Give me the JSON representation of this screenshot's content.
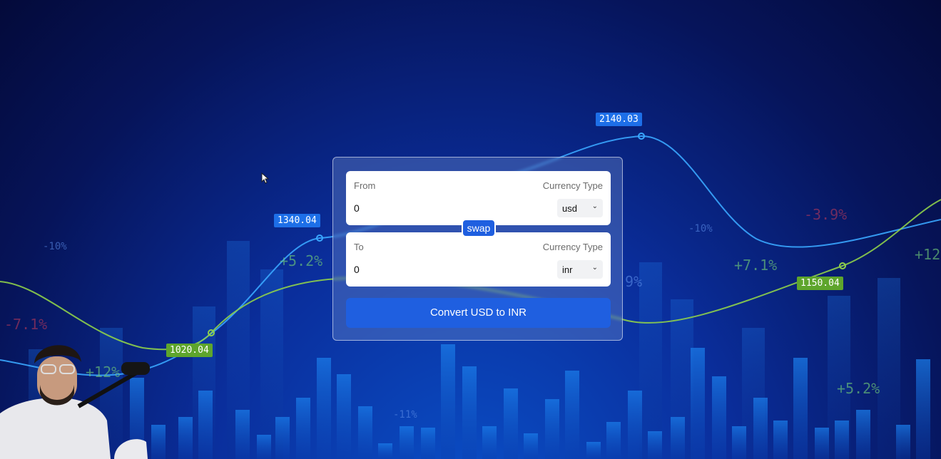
{
  "converter": {
    "from_label": "From",
    "to_label": "To",
    "currency_type_label": "Currency Type",
    "from_amount": "0",
    "to_amount": "0",
    "from_currency": "usd",
    "to_currency": "inr",
    "swap_label": "swap",
    "convert_label": "Convert USD to INR"
  },
  "background": {
    "value_labels": [
      "1340.04",
      "2140.03",
      "1020.04",
      "1150.04"
    ],
    "percent_labels": [
      "+5.2%",
      "-7.1%",
      "+12%",
      "-3.9%",
      "+7.1%",
      "+12",
      "-10%",
      "-10%",
      "9%",
      "-11%",
      "+5.2%"
    ],
    "colors": {
      "accent": "#1f5fe0",
      "green_tag": "#5ea52c",
      "blue_tag": "#1d6fe8"
    }
  },
  "icons": {
    "cursor": "mouse-pointer-icon",
    "select_arrow": "chevron-down-icon"
  }
}
